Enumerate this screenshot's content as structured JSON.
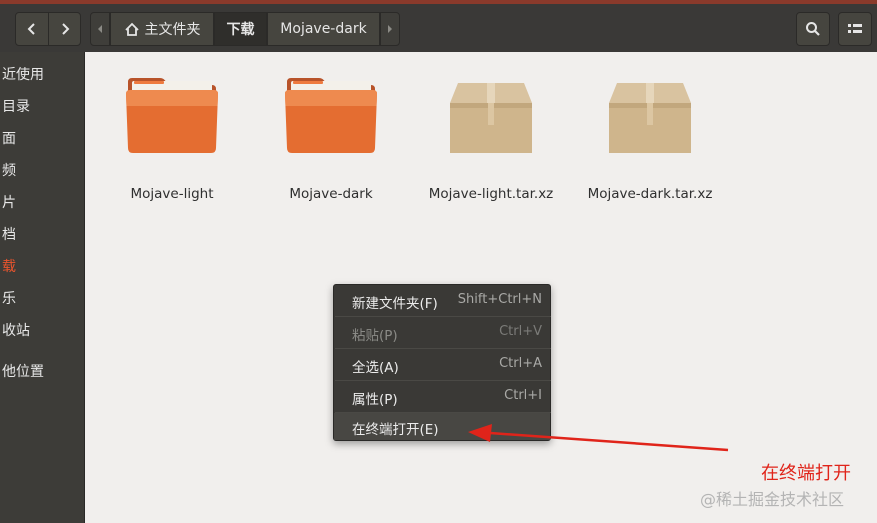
{
  "toolbar": {
    "back_icon": "chevron-left-icon",
    "forward_icon": "chevron-right-icon",
    "breadcrumbs": [
      "主文件夹",
      "下载",
      "Mojave-dark"
    ],
    "home_icon": "home-icon",
    "search_icon": "search-icon",
    "view_icon": "view-menu-icon"
  },
  "sidebar": {
    "items": [
      "近使用",
      "目录",
      "面",
      "频",
      "片",
      "档",
      "载",
      "乐",
      "收站",
      "他位置"
    ],
    "active_index": 6,
    "active_color": "#e9542d"
  },
  "files": [
    {
      "name": "Mojave-light",
      "type": "folder"
    },
    {
      "name": "Mojave-dark",
      "type": "folder"
    },
    {
      "name": "Mojave-light.tar.xz",
      "type": "archive"
    },
    {
      "name": "Mojave-dark.tar.xz",
      "type": "archive"
    }
  ],
  "context_menu": {
    "items": [
      {
        "label": "新建文件夹(F)",
        "shortcut": "Shift+Ctrl+N",
        "enabled": true
      },
      {
        "label": "粘贴(P)",
        "shortcut": "Ctrl+V",
        "enabled": false
      },
      {
        "label": "全选(A)",
        "shortcut": "Ctrl+A",
        "enabled": true
      },
      {
        "label": "属性(P)",
        "shortcut": "Ctrl+I",
        "enabled": true
      },
      {
        "label": "在终端打开(E)",
        "shortcut": "",
        "enabled": true
      }
    ]
  },
  "annotation": {
    "text": "在终端打开",
    "color": "#e0241a"
  },
  "watermark": "@稀土掘金技术社区"
}
